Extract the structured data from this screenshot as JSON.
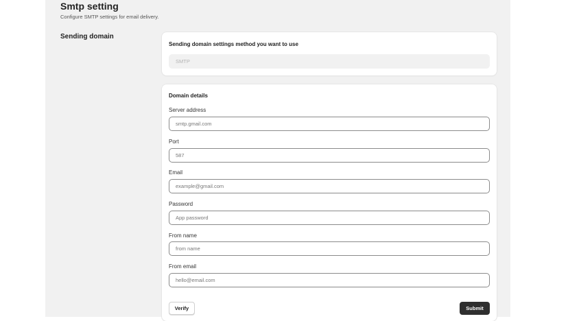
{
  "header": {
    "title": "Smtp setting",
    "subtitle": "Configure SMTP settings for email delivery."
  },
  "sending_domain": {
    "section_label": "Sending domain",
    "method_heading": "Sending domain settings method you want to use",
    "method_value": "SMTP"
  },
  "domain_details": {
    "heading": "Domain details",
    "fields": [
      {
        "label": "Server address",
        "placeholder": "smtp.gmail.com"
      },
      {
        "label": "Port",
        "placeholder": "587"
      },
      {
        "label": "Email",
        "placeholder": "example@gmail.com"
      },
      {
        "label": "Password",
        "placeholder": "App password"
      },
      {
        "label": "From name",
        "placeholder": "from name"
      },
      {
        "label": "From email",
        "placeholder": "hello@email.com"
      }
    ]
  },
  "actions": {
    "verify_label": "Verify",
    "submit_label": "Submit"
  },
  "colors": {
    "page_background": "#f1f1f1",
    "card_background": "#ffffff",
    "submit_background": "#2f2f2f"
  }
}
